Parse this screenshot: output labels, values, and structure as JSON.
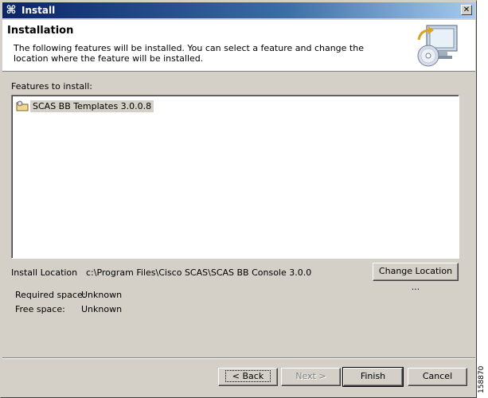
{
  "window": {
    "title": "Install",
    "close_label": "✕",
    "icon": "eclipse-install-icon"
  },
  "header": {
    "title": "Installation",
    "description": "The following features will be installed. You can select a feature and change the location where the feature will be installed.",
    "icon": "monitor-cd-install-icon"
  },
  "features": {
    "label": "Features to install:",
    "items": [
      {
        "label": "SCAS BB Templates 3.0.0.8",
        "icon": "feature-folder-icon",
        "selected": true
      }
    ]
  },
  "location": {
    "label": "Install Location",
    "path": "c:\\Program Files\\Cisco SCAS\\SCAS BB Console 3.0.0",
    "change_button": "Change Location ..."
  },
  "space": {
    "required_label": "Required space:",
    "required_value": "Unknown",
    "free_label": "Free space:",
    "free_value": "Unknown"
  },
  "buttons": {
    "back": "< Back",
    "next": "Next >",
    "finish": "Finish",
    "cancel": "Cancel"
  },
  "figure_id": "158870"
}
